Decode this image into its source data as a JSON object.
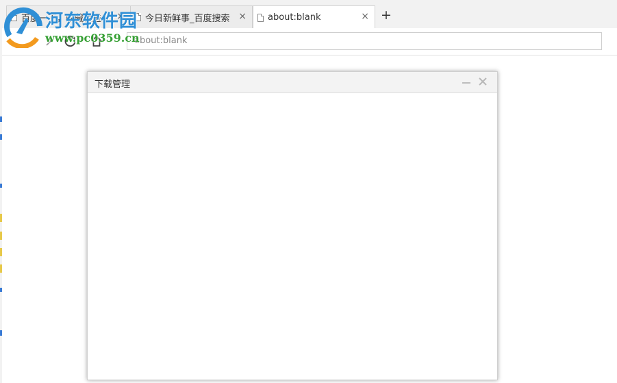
{
  "browser": {
    "tabs": [
      {
        "label": "百度一下，收藏栏进",
        "active": false,
        "close": "×"
      },
      {
        "label": "今日新鲜事_百度搜索",
        "active": false,
        "close": "×"
      },
      {
        "label": "about:blank",
        "active": true,
        "close": "×"
      }
    ],
    "new_tab_label": "+",
    "address_value": "about:blank"
  },
  "watermark": {
    "title": "河东软件园",
    "url": "www.pc0359.cn"
  },
  "dialog": {
    "title": "下载管理",
    "minimize_label": "",
    "close_label": ""
  },
  "colors": {
    "watermark_blue": "#2f8fd6",
    "watermark_green": "#37a035"
  },
  "icons": [
    "page-icon",
    "reload-icon",
    "home-icon",
    "forward-arrow-icon",
    "minimize-icon",
    "close-icon"
  ]
}
